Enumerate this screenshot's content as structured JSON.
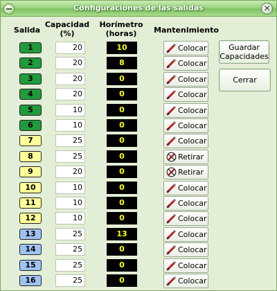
{
  "window": {
    "title": "Configuraciones de las salidas",
    "close_glyph": "✕"
  },
  "headers": {
    "salida": "Salida",
    "capacidad_line1": "Capacidad",
    "capacidad_line2": "(%)",
    "horimetro_line1": "Horímetro",
    "horimetro_line2": "(horas)",
    "mantenimiento": "Mantenimiento"
  },
  "buttons": {
    "guardar_line1": "Guardar",
    "guardar_line2": "Capacidades",
    "cerrar": "Cerrar"
  },
  "colors": {
    "green": "#1f9b3c",
    "yellow": "#ffff99",
    "blue": "#9ec3f3",
    "hor_text": "#ffff00"
  },
  "rows": [
    {
      "salida": "1",
      "color": "green",
      "capacidad": "20",
      "horimetro": "10",
      "action": "Colocar",
      "icon": "pencil-icon"
    },
    {
      "salida": "2",
      "color": "green",
      "capacidad": "20",
      "horimetro": "8",
      "action": "Colocar",
      "icon": "pencil-icon"
    },
    {
      "salida": "3",
      "color": "green",
      "capacidad": "20",
      "horimetro": "0",
      "action": "Colocar",
      "icon": "pencil-icon"
    },
    {
      "salida": "4",
      "color": "green",
      "capacidad": "20",
      "horimetro": "0",
      "action": "Colocar",
      "icon": "pencil-icon"
    },
    {
      "salida": "5",
      "color": "green",
      "capacidad": "10",
      "horimetro": "0",
      "action": "Colocar",
      "icon": "pencil-icon"
    },
    {
      "salida": "6",
      "color": "green",
      "capacidad": "10",
      "horimetro": "0",
      "action": "Colocar",
      "icon": "pencil-icon"
    },
    {
      "salida": "7",
      "color": "yellow",
      "capacidad": "25",
      "horimetro": "0",
      "action": "Colocar",
      "icon": "pencil-icon"
    },
    {
      "salida": "8",
      "color": "yellow",
      "capacidad": "25",
      "horimetro": "0",
      "action": "Retirar",
      "icon": "no-pencil-icon"
    },
    {
      "salida": "9",
      "color": "yellow",
      "capacidad": "20",
      "horimetro": "0",
      "action": "Retirar",
      "icon": "no-pencil-icon"
    },
    {
      "salida": "10",
      "color": "yellow",
      "capacidad": "10",
      "horimetro": "0",
      "action": "Colocar",
      "icon": "pencil-icon"
    },
    {
      "salida": "11",
      "color": "yellow",
      "capacidad": "10",
      "horimetro": "0",
      "action": "Colocar",
      "icon": "pencil-icon"
    },
    {
      "salida": "12",
      "color": "yellow",
      "capacidad": "10",
      "horimetro": "0",
      "action": "Colocar",
      "icon": "pencil-icon"
    },
    {
      "salida": "13",
      "color": "blue",
      "capacidad": "25",
      "horimetro": "13",
      "action": "Colocar",
      "icon": "pencil-icon"
    },
    {
      "salida": "14",
      "color": "blue",
      "capacidad": "25",
      "horimetro": "0",
      "action": "Colocar",
      "icon": "pencil-icon"
    },
    {
      "salida": "15",
      "color": "blue",
      "capacidad": "25",
      "horimetro": "0",
      "action": "Colocar",
      "icon": "pencil-icon"
    },
    {
      "salida": "16",
      "color": "blue",
      "capacidad": "25",
      "horimetro": "0",
      "action": "Colocar",
      "icon": "pencil-icon"
    }
  ]
}
